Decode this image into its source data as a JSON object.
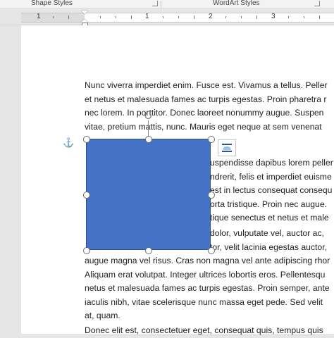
{
  "ribbon": {
    "groups": [
      {
        "label": "Shape Styles"
      },
      {
        "label": "WordArt Styles"
      }
    ]
  },
  "ruler": {
    "numbers": [
      "1",
      "1",
      "2",
      "3"
    ]
  },
  "document": {
    "paragraph1": [
      "Nunc viverra imperdiet enim. Fusce est. Vivamus a tellus. Peller",
      "et netus et malesuada fames ac turpis egestas. Proin pharetra r",
      "nec lorem. In porttitor. Donec laoreet nonummy augue. Suspen",
      "vitae, pretium mattis, nunc. Mauris eget neque at sem venenat"
    ],
    "paragraph2_right": [
      "uspendisse dapibus lorem peller",
      "ndrerit, felis et imperdiet euisme",
      "est in lectus consequat consequ",
      "orta tristique. Proin nec augue.",
      "tique senectus et netus et male"
    ],
    "paragraph3_right": [
      "dolor, vulputate vel, auctor ac,",
      "tor, velit lacinia egestas auctor,"
    ],
    "paragraph3_full": [
      "augue magna vel risus. Cras non magna vel ante adipiscing rhor",
      "Aliquam erat volutpat. Integer ultrices lobortis eros. Pellentesqu",
      "netus et malesuada fames ac turpis egestas. Proin semper, ante",
      "iaculis nibh, vitae scelerisque nunc massa eget pede. Sed velit",
      "at, quam."
    ],
    "paragraph4": [
      "Donec elit est, consectetuer eget, consequat quis, tempus quis"
    ]
  },
  "shape": {
    "fill_color": "#4472c4",
    "anchor_icon": "anchor-icon",
    "rotate_icon": "rotate-icon",
    "layout_options_icon": "layout-options-icon"
  }
}
